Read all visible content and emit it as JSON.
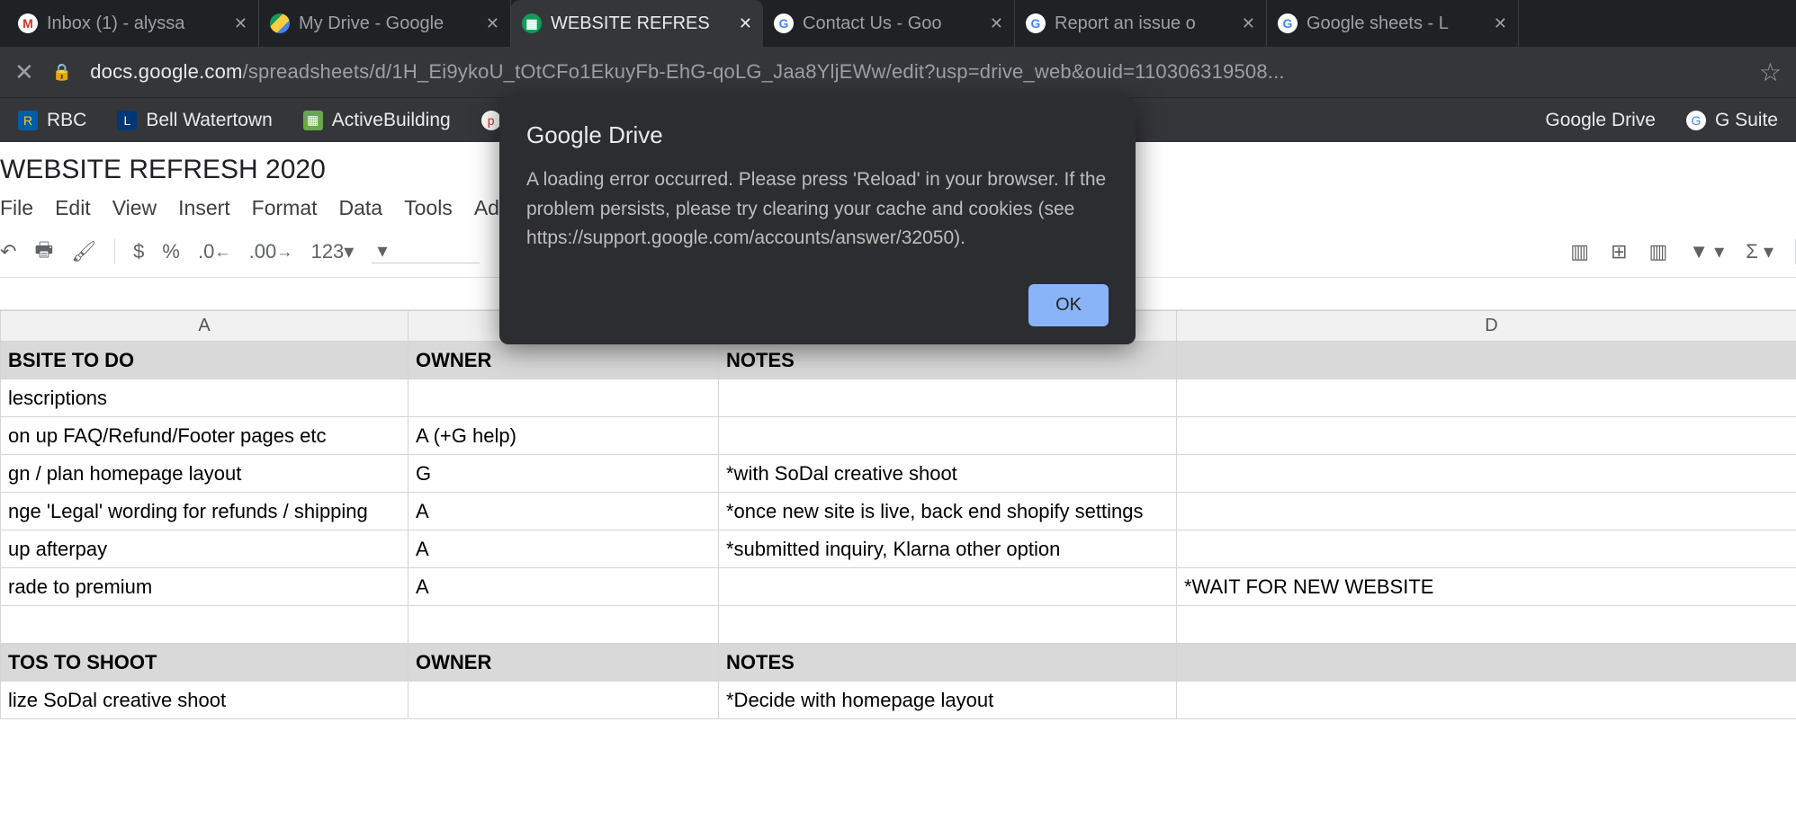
{
  "tabs": [
    {
      "title": "Inbox (1) - alyssa",
      "favicon": "gmail"
    },
    {
      "title": "My Drive - Google",
      "favicon": "drive"
    },
    {
      "title": "WEBSITE REFRES",
      "favicon": "sheets",
      "active": true
    },
    {
      "title": "Contact Us - Goo",
      "favicon": "google"
    },
    {
      "title": "Report an issue o",
      "favicon": "google"
    },
    {
      "title": "Google sheets - L",
      "favicon": "google"
    }
  ],
  "url": {
    "host": "docs.google.com",
    "path": "/spreadsheets/d/1H_Ei9ykoU_tOtCFo1EkuyFb-EhG-qoLG_Jaa8YljEWw/edit?usp=drive_web&ouid=110306319508..."
  },
  "bookmarks": {
    "left": [
      "RBC",
      "Bell Watertown",
      "ActiveBuilding"
    ],
    "right": [
      "Google Drive",
      "G Suite"
    ]
  },
  "doc_title": "WEBSITE REFRESH 2020",
  "menu": [
    "File",
    "Edit",
    "View",
    "Insert",
    "Format",
    "Data",
    "Tools",
    "Add-o"
  ],
  "toolbar": {
    "currency": "$",
    "percent": "%",
    "dec0": ".0",
    "dec00": ".00",
    "numfmt": "123"
  },
  "columns": [
    "A",
    "",
    "",
    "D"
  ],
  "rows": [
    {
      "type": "hdr",
      "cells": [
        "BSITE TO DO",
        "OWNER",
        "NOTES",
        ""
      ]
    },
    {
      "type": "data",
      "cells": [
        "lescriptions",
        "",
        "",
        ""
      ]
    },
    {
      "type": "data",
      "cells": [
        "on up FAQ/Refund/Footer pages etc",
        "A (+G help)",
        "",
        ""
      ]
    },
    {
      "type": "data",
      "cells": [
        "gn / plan homepage layout",
        "G",
        "*with SoDal creative shoot",
        ""
      ]
    },
    {
      "type": "data",
      "cells": [
        "nge 'Legal' wording for refunds / shipping",
        "A",
        "*once new site is live, back end shopify settings",
        ""
      ]
    },
    {
      "type": "data",
      "cells": [
        "up afterpay",
        "A",
        "*submitted inquiry, Klarna other option",
        ""
      ]
    },
    {
      "type": "data",
      "cells": [
        "rade to premium",
        "A",
        "",
        "*WAIT FOR NEW WEBSITE"
      ]
    },
    {
      "type": "data",
      "cells": [
        "",
        "",
        "",
        ""
      ]
    },
    {
      "type": "hdr",
      "cells": [
        "TOS TO SHOOT",
        "OWNER",
        "NOTES",
        ""
      ]
    },
    {
      "type": "data",
      "cells": [
        "lize SoDal creative shoot",
        "",
        "*Decide with homepage layout",
        ""
      ]
    }
  ],
  "modal": {
    "title": "Google Drive",
    "body": "A loading error occurred. Please press 'Reload' in your browser. If the problem persists, please try clearing your cache and cookies (see https://support.google.com/accounts/answer/32050).",
    "ok": "OK"
  }
}
